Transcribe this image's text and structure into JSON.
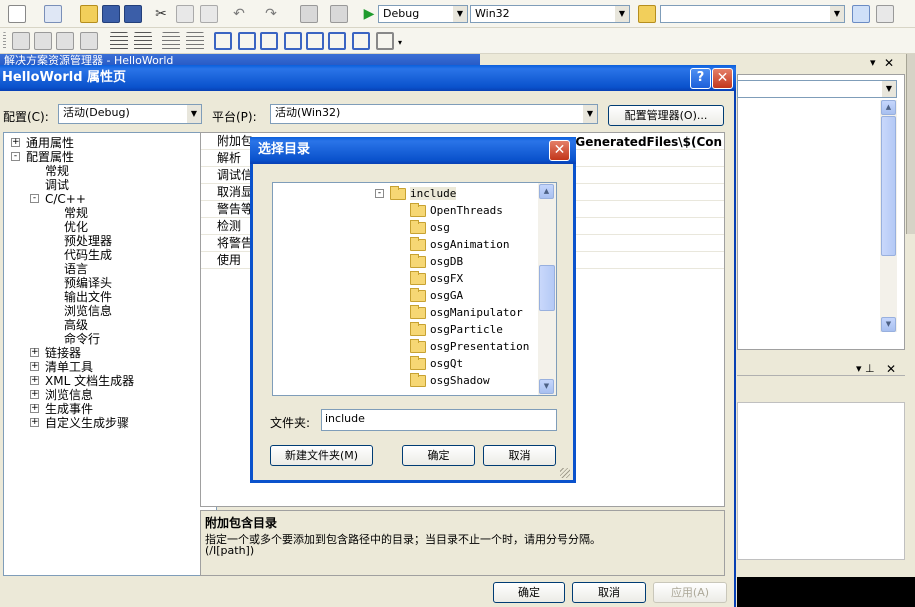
{
  "ide": {
    "config_combo": "Debug",
    "platform_combo": "Win32",
    "solution_explorer_title": "解决方案资源管理器 - HelloWorld"
  },
  "props": {
    "title": "HelloWorld 属性页",
    "config_label": "配置(C):",
    "config_value": "活动(Debug)",
    "platform_label": "平台(P):",
    "platform_value": "活动(Win32)",
    "config_manager_button": "配置管理器(O)...",
    "tree": [
      {
        "label": "通用属性",
        "level": 0,
        "box": "+"
      },
      {
        "label": "配置属性",
        "level": 0,
        "box": "-"
      },
      {
        "label": "常规",
        "level": 1,
        "box": ""
      },
      {
        "label": "调试",
        "level": 1,
        "box": ""
      },
      {
        "label": "C/C++",
        "level": 1,
        "box": "-"
      },
      {
        "label": "常规",
        "level": 2,
        "box": ""
      },
      {
        "label": "优化",
        "level": 2,
        "box": ""
      },
      {
        "label": "预处理器",
        "level": 2,
        "box": ""
      },
      {
        "label": "代码生成",
        "level": 2,
        "box": ""
      },
      {
        "label": "语言",
        "level": 2,
        "box": ""
      },
      {
        "label": "预编译头",
        "level": 2,
        "box": ""
      },
      {
        "label": "输出文件",
        "level": 2,
        "box": ""
      },
      {
        "label": "浏览信息",
        "level": 2,
        "box": ""
      },
      {
        "label": "高级",
        "level": 2,
        "box": ""
      },
      {
        "label": "命令行",
        "level": 2,
        "box": ""
      },
      {
        "label": "链接器",
        "level": 1,
        "box": "+"
      },
      {
        "label": "清单工具",
        "level": 1,
        "box": "+"
      },
      {
        "label": "XML 文档生成器",
        "level": 1,
        "box": "+"
      },
      {
        "label": "浏览信息",
        "level": 1,
        "box": "+"
      },
      {
        "label": "生成事件",
        "level": 1,
        "box": "+"
      },
      {
        "label": "自定义生成步骤",
        "level": 1,
        "box": "+"
      }
    ],
    "grid_rows": [
      "附加包",
      "解析",
      "调试信",
      "取消显",
      "警告等",
      "检测",
      "将警告",
      "使用"
    ],
    "grid_value_first": "\\GeneratedFiles\\$(Con",
    "desc_title": "附加包含目录",
    "desc_text": "指定一个或多个要添加到包含路径中的目录；当目录不止一个时，请用分号分隔。",
    "desc_switch": "(/I[path])",
    "ok_button": "确定",
    "cancel_button": "取消",
    "apply_button": "应用(A)"
  },
  "browse": {
    "title": "选择目录",
    "folders": [
      "include",
      "OpenThreads",
      "osg",
      "osgAnimation",
      "osgDB",
      "osgFX",
      "osgGA",
      "osgManipulator",
      "osgParticle",
      "osgPresentation",
      "osgQt",
      "osgShadow"
    ],
    "folder_label": "文件夹:",
    "folder_value": "include",
    "new_folder_button": "新建文件夹(M)",
    "ok_button": "确定",
    "cancel_button": "取消"
  }
}
